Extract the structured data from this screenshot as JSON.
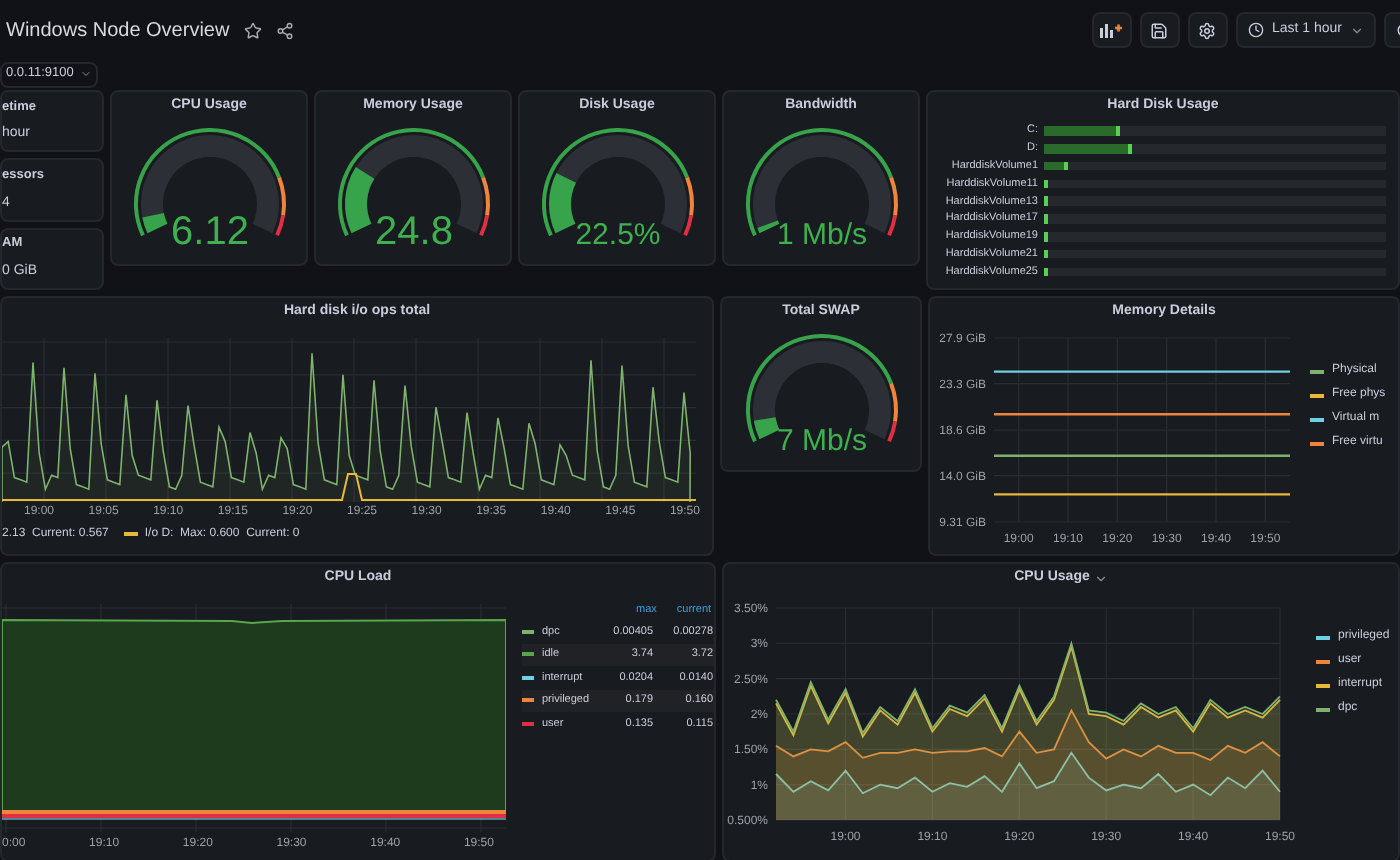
{
  "header": {
    "title": "Windows Node Overview",
    "time_range": "Last 1 hour"
  },
  "variable": {
    "value": "0.0.11:9100"
  },
  "stats": [
    {
      "label": "etime",
      "value": "hour"
    },
    {
      "label": "essors",
      "value": "4"
    },
    {
      "label": "AM",
      "value": "0 GiB"
    }
  ],
  "gauges": [
    {
      "title": "CPU Usage",
      "value": "6.12",
      "level": 0.06
    },
    {
      "title": "Memory Usage",
      "value": "24.8",
      "level": 0.25
    },
    {
      "title": "Disk Usage",
      "value": "22.5%",
      "level": 0.225
    },
    {
      "title": "Bandwidth",
      "value": "1 Mb/s",
      "level": 0.02
    }
  ],
  "disk_usage": {
    "title": "Hard Disk Usage",
    "bars": [
      {
        "label": "C:",
        "level": 0.22
      },
      {
        "label": "D:",
        "level": 0.26
      },
      {
        "label": "HarddiskVolume1",
        "level": 0.07
      },
      {
        "label": "HarddiskVolume11",
        "level": 0.008
      },
      {
        "label": "HarddiskVolume13",
        "level": 0.008
      },
      {
        "label": "HarddiskVolume17",
        "level": 0.008
      },
      {
        "label": "HarddiskVolume19",
        "level": 0.008
      },
      {
        "label": "HarddiskVolume21",
        "level": 0.008
      },
      {
        "label": "HarddiskVolume25",
        "level": 0.008
      }
    ]
  },
  "io_panel": {
    "title": "Hard disk i/o ops total",
    "x_labels": [
      "19:00",
      "19:05",
      "19:10",
      "19:15",
      "19:20",
      "19:25",
      "19:30",
      "19:35",
      "19:40",
      "19:45",
      "19:50"
    ],
    "legend": [
      {
        "text": "2.13  Current: 0.567"
      },
      {
        "text": "I/o D:  Max: 0.600  Current: 0",
        "color": "#eab839"
      }
    ]
  },
  "swap": {
    "title": "Total SWAP",
    "value": "7 Mb/s",
    "level": 0.07
  },
  "memory": {
    "title": "Memory Details",
    "chart_data": {
      "type": "line",
      "grid": true,
      "ylim": [
        9.31,
        27.9
      ],
      "categories": [
        null,
        "19:00",
        null,
        "19:10",
        null,
        "19:20",
        null,
        "19:30",
        null,
        "19:40",
        null,
        "19:50",
        null
      ],
      "yticks": [
        {
          "value": 9.31,
          "label": "9.31 GiB"
        },
        {
          "value": 14.0,
          "label": "14.0 GiB"
        },
        {
          "value": 18.6,
          "label": "18.6 GiB"
        },
        {
          "value": 23.3,
          "label": "23.3 GiB"
        },
        {
          "value": 27.9,
          "label": "27.9 GiB"
        }
      ],
      "series": [
        {
          "name": "Physical",
          "color": "#7eb26d",
          "values": [
            16.0,
            16.0,
            16.0,
            16.0,
            16.0,
            16.0,
            16.0,
            16.0,
            16.0,
            16.0,
            16.0,
            16.0,
            16.0
          ]
        },
        {
          "name": "Free phys",
          "color": "#eab839",
          "values": [
            12.1,
            12.1,
            12.1,
            12.1,
            12.1,
            12.1,
            12.1,
            12.1,
            12.1,
            12.1,
            12.1,
            12.1,
            12.1
          ]
        },
        {
          "name": "Virtual m",
          "color": "#6ed0e0",
          "values": [
            24.5,
            24.5,
            24.5,
            24.5,
            24.5,
            24.5,
            24.5,
            24.5,
            24.5,
            24.5,
            24.5,
            24.5,
            24.5
          ]
        },
        {
          "name": "Free virtu",
          "color": "#ef843c",
          "values": [
            20.2,
            20.2,
            20.2,
            20.2,
            20.2,
            20.2,
            20.2,
            20.2,
            20.2,
            20.2,
            20.2,
            20.2,
            20.2
          ]
        }
      ]
    }
  },
  "cpu_load": {
    "title": "CPU Load",
    "x_labels": [
      "0:00",
      "19:10",
      "19:20",
      "19:30",
      "19:40",
      "19:50"
    ],
    "columns": [
      "max",
      "current"
    ],
    "legend": [
      {
        "name": "dpc",
        "color": "#7eb26d",
        "max": "0.00405",
        "current": "0.00278"
      },
      {
        "name": "idle",
        "color": "#56a64b",
        "max": "3.74",
        "current": "3.72"
      },
      {
        "name": "interrupt",
        "color": "#6ed0e0",
        "max": "0.0204",
        "current": "0.0140"
      },
      {
        "name": "privileged",
        "color": "#ef843c",
        "max": "0.179",
        "current": "0.160"
      },
      {
        "name": "user",
        "color": "#e02f44",
        "max": "0.135",
        "current": "0.115"
      }
    ]
  },
  "cpu_usage": {
    "title": "CPU Usage",
    "chart_data": {
      "type": "area",
      "grid": true,
      "ylim": [
        0.5,
        3.5
      ],
      "categories": [
        null,
        null,
        null,
        null,
        "19:00",
        null,
        null,
        null,
        null,
        "19:10",
        null,
        null,
        null,
        null,
        "19:20",
        null,
        null,
        null,
        null,
        "19:30",
        null,
        null,
        null,
        null,
        "19:40",
        null,
        null,
        null,
        null,
        "19:50"
      ],
      "yticks": [
        {
          "value": 0.5,
          "label": "0.500%"
        },
        {
          "value": 1,
          "label": "1%"
        },
        {
          "value": 1.5,
          "label": "1.50%"
        },
        {
          "value": 2,
          "label": "2%"
        },
        {
          "value": 2.5,
          "label": "2.50%"
        },
        {
          "value": 3,
          "label": "3%"
        },
        {
          "value": 3.5,
          "label": "3.50%"
        }
      ],
      "series": [
        {
          "name": "privileged",
          "color": "#6ed0e0",
          "values": [
            1.15,
            0.9,
            1.05,
            0.92,
            1.2,
            0.88,
            1.0,
            0.95,
            1.1,
            0.9,
            1.02,
            0.97,
            1.12,
            0.9,
            1.3,
            0.95,
            1.05,
            1.45,
            1.1,
            0.92,
            1.0,
            0.95,
            1.15,
            0.9,
            1.0,
            0.85,
            1.1,
            0.95,
            1.2,
            0.9
          ]
        },
        {
          "name": "user",
          "color": "#ef843c",
          "values": [
            1.55,
            1.4,
            1.5,
            1.47,
            1.6,
            1.38,
            1.45,
            1.45,
            1.5,
            1.45,
            1.47,
            1.47,
            1.52,
            1.4,
            1.75,
            1.45,
            1.5,
            2.05,
            1.6,
            1.37,
            1.5,
            1.4,
            1.55,
            1.45,
            1.45,
            1.35,
            1.55,
            1.45,
            1.6,
            1.4
          ]
        },
        {
          "name": "interrupt",
          "color": "#eab839",
          "values": [
            2.15,
            1.7,
            2.4,
            1.87,
            2.3,
            1.68,
            2.05,
            1.85,
            2.3,
            1.75,
            2.07,
            1.97,
            2.22,
            1.75,
            2.35,
            1.85,
            2.2,
            2.95,
            2.0,
            1.97,
            1.85,
            2.1,
            1.95,
            2.05,
            1.75,
            2.15,
            1.95,
            2.05,
            1.95,
            2.2
          ]
        },
        {
          "name": "dpc",
          "color": "#7eb26d",
          "values": [
            2.2,
            1.75,
            2.45,
            1.92,
            2.35,
            1.73,
            2.1,
            1.9,
            2.35,
            1.8,
            2.12,
            2.02,
            2.27,
            1.8,
            2.4,
            1.9,
            2.25,
            3.0,
            2.05,
            2.02,
            1.9,
            2.15,
            2.0,
            2.1,
            1.8,
            2.2,
            2.0,
            2.1,
            2.0,
            2.25
          ]
        }
      ]
    }
  }
}
